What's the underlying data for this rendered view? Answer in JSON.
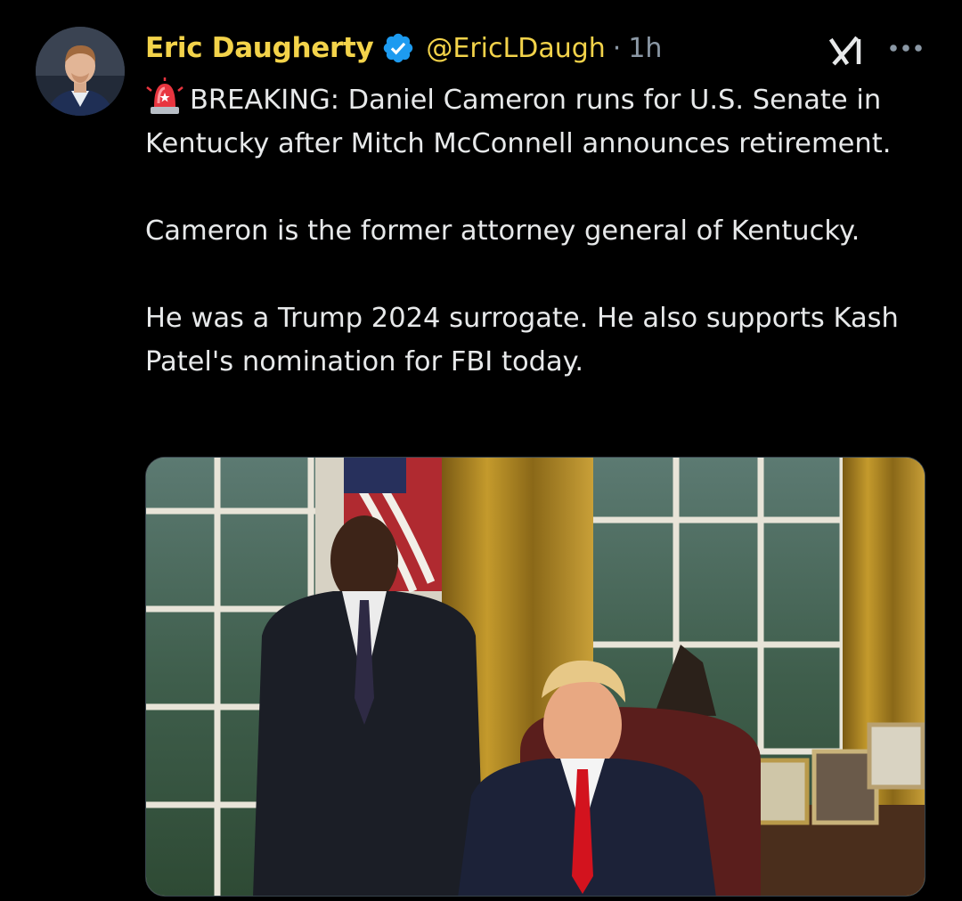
{
  "tweet": {
    "author": {
      "display_name": "Eric Daugherty",
      "handle": "@EricLDaugh",
      "verified": true
    },
    "separator": "·",
    "time": "1h",
    "icons": {
      "verified": "verified-badge-icon",
      "grok": "grok-icon",
      "more": "more-options-icon",
      "siren": "police-light-emoji-icon"
    },
    "text": {
      "line1": "BREAKING: Daniel Cameron runs for U.S. Senate in Kentucky after Mitch McConnell announces retirement.",
      "line2": "Cameron is the former attorney general of Kentucky.",
      "line3": "He was a Trump 2024 surrogate. He also supports Kash Patel's nomination for FBI today."
    }
  },
  "colors": {
    "background": "#000000",
    "name": "#f3d34a",
    "text": "#e7e9ea",
    "muted": "#8b98a5",
    "verified": "#1d9bf0"
  }
}
